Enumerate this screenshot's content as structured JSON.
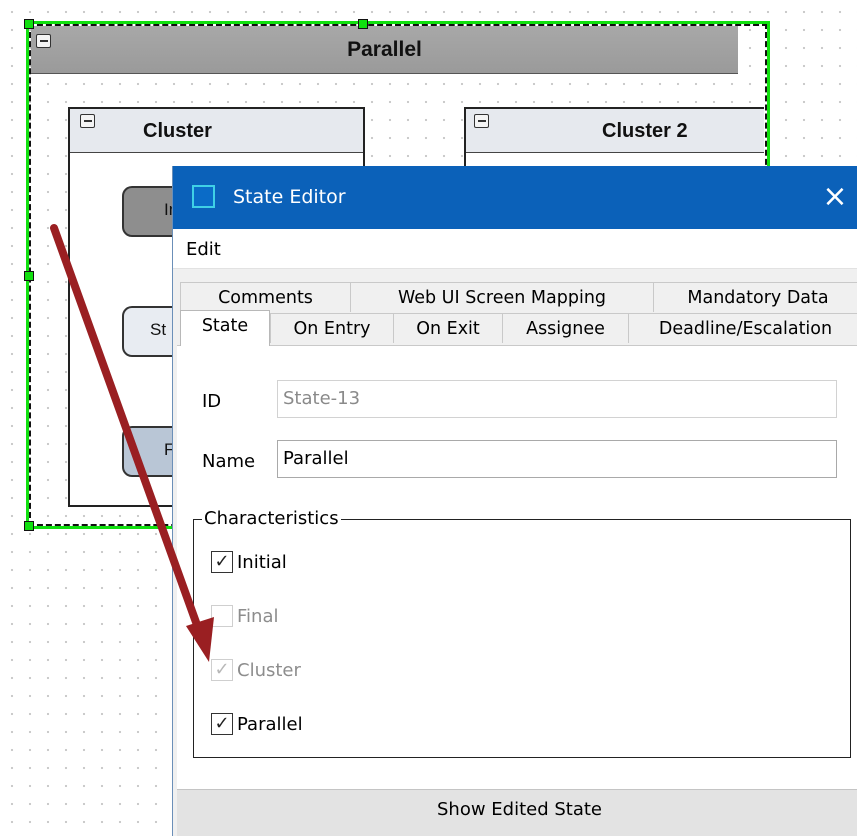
{
  "diagram": {
    "parallel_title": "Parallel",
    "cluster1": {
      "title": "Cluster",
      "nodes": [
        "In",
        "St",
        "Fi"
      ]
    },
    "cluster2": {
      "title": "Cluster 2"
    },
    "colors": {
      "selection": "#11e00f",
      "parallel_header": "#a0a0a0",
      "cluster_header": "#e6e9ee",
      "arrow": "#9a1f22"
    }
  },
  "editor": {
    "title": "State Editor",
    "close_icon": "×",
    "menu": {
      "edit": "Edit"
    },
    "tabs_row1": [
      "Comments",
      "Web UI Screen Mapping",
      "Mandatory Data"
    ],
    "tabs_row2": [
      "State",
      "On Entry",
      "On Exit",
      "Assignee",
      "Deadline/Escalation"
    ],
    "active_tab": "State",
    "fields": {
      "id_label": "ID",
      "id_value": "State-13",
      "name_label": "Name",
      "name_value": "Parallel"
    },
    "characteristics": {
      "legend": "Characteristics",
      "items": [
        {
          "label": "Initial",
          "checked": true,
          "enabled": true
        },
        {
          "label": "Final",
          "checked": false,
          "enabled": false
        },
        {
          "label": "Cluster",
          "checked": true,
          "enabled": false
        },
        {
          "label": "Parallel",
          "checked": true,
          "enabled": true
        }
      ]
    },
    "show_edited_button": "Show Edited State",
    "colors": {
      "titlebar": "#0b61b9",
      "icon_border": "#3fd0e6"
    }
  }
}
